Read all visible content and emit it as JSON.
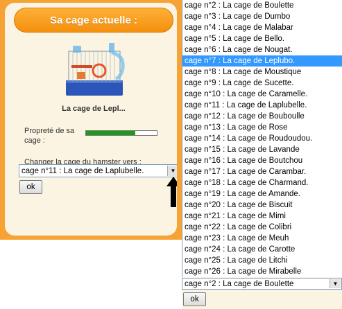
{
  "panel": {
    "title": "Sa cage actuelle :",
    "cage_name": "La cage de Lepl...",
    "cleanliness_label": "Propreté de sa cage :",
    "cleanliness_level": 0.7,
    "change_label": "Changer la cage du hamster vers :",
    "current_select_value": "cage n°11 : La cage de Laplubelle.",
    "ok_label": "ok"
  },
  "dropdown": {
    "options": [
      "cage n°2 : La cage de Boulette",
      "cage n°3 : La cage de Dumbo",
      "cage n°4 : La cage de Malabar",
      "cage n°5 : La cage de Bello.",
      "cage n°6 : La cage de Nougat.",
      "cage n°7 : La cage de Leplubo.",
      "cage n°8 : La cage de Moustique",
      "cage n°9 : La cage de Sucette.",
      "cage n°10 : La cage de Caramelle.",
      "cage n°11 : La cage de Laplubelle.",
      "cage n°12 : La cage de Bouboulle",
      "cage n°13 : La cage de Rose",
      "cage n°14 : La cage de Roudoudou.",
      "cage n°15 : La cage de Lavande",
      "cage n°16 : La cage de Boutchou",
      "cage n°17 : La cage de Carambar.",
      "cage n°18 : La cage de Charmand.",
      "cage n°19 : La cage de Amande.",
      "cage n°20 : La cage de Biscuit",
      "cage n°21 : La cage de Mimi",
      "cage n°22 : La cage de Colibri",
      "cage n°23 : La cage de Meuh",
      "cage n°24 : La cage de Carotte",
      "cage n°25 : La cage de Litchi",
      "cage n°26 : La cage de Mirabelle"
    ],
    "highlighted_index": 5,
    "bottom_select_value": "cage n°2 : La cage de Boulette",
    "bottom_ok_label": "ok"
  },
  "colors": {
    "orange": "#f7a235",
    "panel": "#fbf4e2",
    "highlight": "#3399ff",
    "meter": "#1a9a1a"
  },
  "icons": {
    "cage_image": "hamster-cage-image",
    "dropdown_arrow": "chevron-down-icon",
    "pointer_arrow": "up-arrow-icon"
  }
}
